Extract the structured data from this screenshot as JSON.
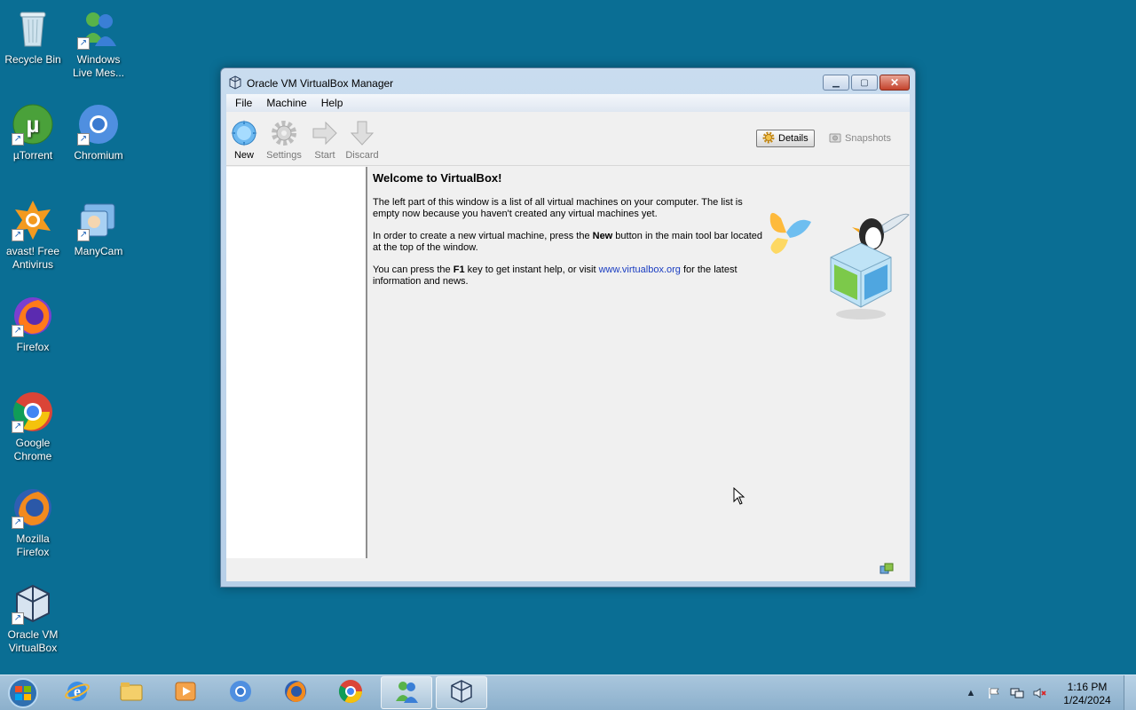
{
  "desktop": {
    "icons": [
      {
        "label": "Recycle Bin",
        "icon": "recycle-bin-icon"
      },
      {
        "label": "Windows Live Mes...",
        "icon": "messenger-icon"
      },
      {
        "label": "µTorrent",
        "icon": "utorrent-icon"
      },
      {
        "label": "Chromium",
        "icon": "chromium-icon"
      },
      {
        "label": "avast! Free Antivirus",
        "icon": "avast-icon"
      },
      {
        "label": "ManyCam",
        "icon": "manycam-icon"
      },
      {
        "label": "Firefox",
        "icon": "firefox-icon"
      },
      {
        "label": "Google Chrome",
        "icon": "chrome-icon"
      },
      {
        "label": "Mozilla Firefox",
        "icon": "firefox-icon"
      },
      {
        "label": "Oracle VM VirtualBox",
        "icon": "virtualbox-icon"
      }
    ]
  },
  "window": {
    "title": "Oracle VM VirtualBox Manager",
    "menu": [
      "File",
      "Machine",
      "Help"
    ],
    "toolbar": {
      "new": "New",
      "settings": "Settings",
      "start": "Start",
      "discard": "Discard",
      "details": "Details",
      "snapshots": "Snapshots"
    },
    "welcome": {
      "title": "Welcome to VirtualBox!",
      "p1": "The left part of this window is a list of all virtual machines on your computer. The list is empty now because you haven't created any virtual machines yet.",
      "p2_pre": "In order to create a new virtual machine, press the ",
      "p2_bold": "New",
      "p2_post": " button in the main tool bar located at the top of the window.",
      "p3_pre": "You can press the ",
      "p3_bold": "F1",
      "p3_mid": " key to get instant help, or visit ",
      "p3_link": "www.virtualbox.org",
      "p3_post": " for the latest information and news."
    }
  },
  "taskbar": {
    "items": [
      "ie-icon",
      "explorer-icon",
      "media-player-icon",
      "chromium-icon",
      "firefox-icon",
      "chrome-icon",
      "messenger-icon",
      "virtualbox-icon"
    ],
    "clock_time": "1:16 PM",
    "clock_date": "1/24/2024"
  },
  "colors": {
    "desktop": "#0a6e94",
    "link": "#1a3dc1"
  }
}
